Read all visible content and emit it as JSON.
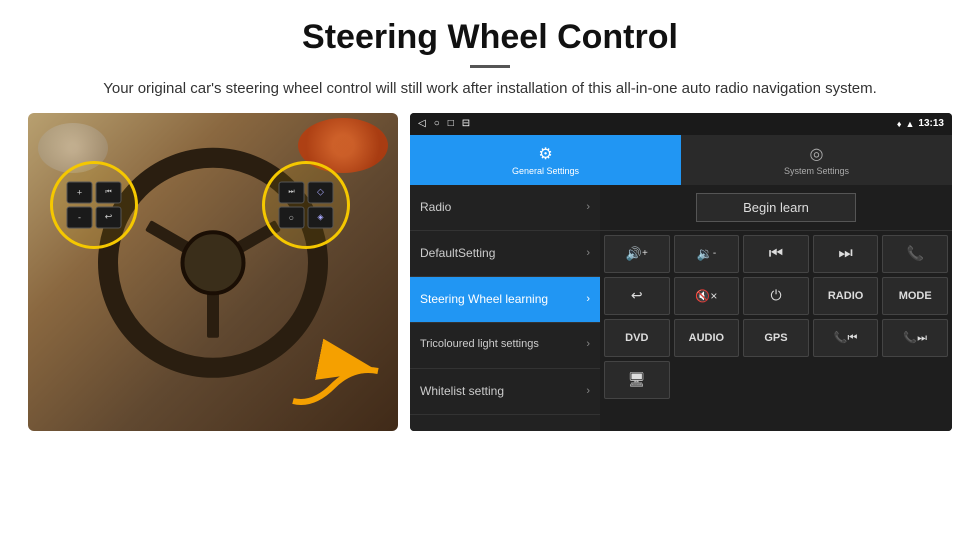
{
  "header": {
    "title": "Steering Wheel Control",
    "divider": true,
    "subtitle": "Your original car's steering wheel control will still work after installation of this all-in-one auto radio navigation system."
  },
  "statusbar": {
    "icons": [
      "◁",
      "○",
      "□",
      "⊟"
    ],
    "right_icons": [
      "♥",
      "▼"
    ],
    "time": "13:13"
  },
  "nav_tabs": [
    {
      "id": "general",
      "icon": "⚙",
      "label": "General Settings",
      "active": true
    },
    {
      "id": "system",
      "icon": "◎",
      "label": "System Settings",
      "active": false
    }
  ],
  "menu_items": [
    {
      "id": "radio",
      "label": "Radio",
      "active": false
    },
    {
      "id": "default",
      "label": "DefaultSetting",
      "active": false
    },
    {
      "id": "steering",
      "label": "Steering Wheel learning",
      "active": true
    },
    {
      "id": "tricolour",
      "label": "Tricoloured light settings",
      "active": false
    },
    {
      "id": "whitelist",
      "label": "Whitelist setting",
      "active": false
    }
  ],
  "right_panel": {
    "begin_learn_label": "Begin learn",
    "button_rows": [
      [
        {
          "id": "vol_up",
          "label": "🔊+",
          "type": "icon"
        },
        {
          "id": "vol_down",
          "label": "🔉-",
          "type": "icon"
        },
        {
          "id": "prev_track",
          "label": "⏮",
          "type": "icon"
        },
        {
          "id": "next_track",
          "label": "⏭",
          "type": "icon"
        },
        {
          "id": "phone",
          "label": "📞",
          "type": "icon"
        }
      ],
      [
        {
          "id": "hook",
          "label": "↩",
          "type": "icon"
        },
        {
          "id": "mute",
          "label": "🔇x",
          "type": "icon"
        },
        {
          "id": "power",
          "label": "⏻",
          "type": "icon"
        },
        {
          "id": "radio_btn",
          "label": "RADIO",
          "type": "text"
        },
        {
          "id": "mode_btn",
          "label": "MODE",
          "type": "text"
        }
      ],
      [
        {
          "id": "dvd_btn",
          "label": "DVD",
          "type": "text"
        },
        {
          "id": "audio_btn",
          "label": "AUDIO",
          "type": "text"
        },
        {
          "id": "gps_btn",
          "label": "GPS",
          "type": "text"
        },
        {
          "id": "tel_prev",
          "label": "📞⏮",
          "type": "icon"
        },
        {
          "id": "tel_next",
          "label": "📞⏭",
          "type": "icon"
        }
      ],
      [
        {
          "id": "media_icon",
          "label": "🖥",
          "type": "icon"
        }
      ]
    ]
  }
}
